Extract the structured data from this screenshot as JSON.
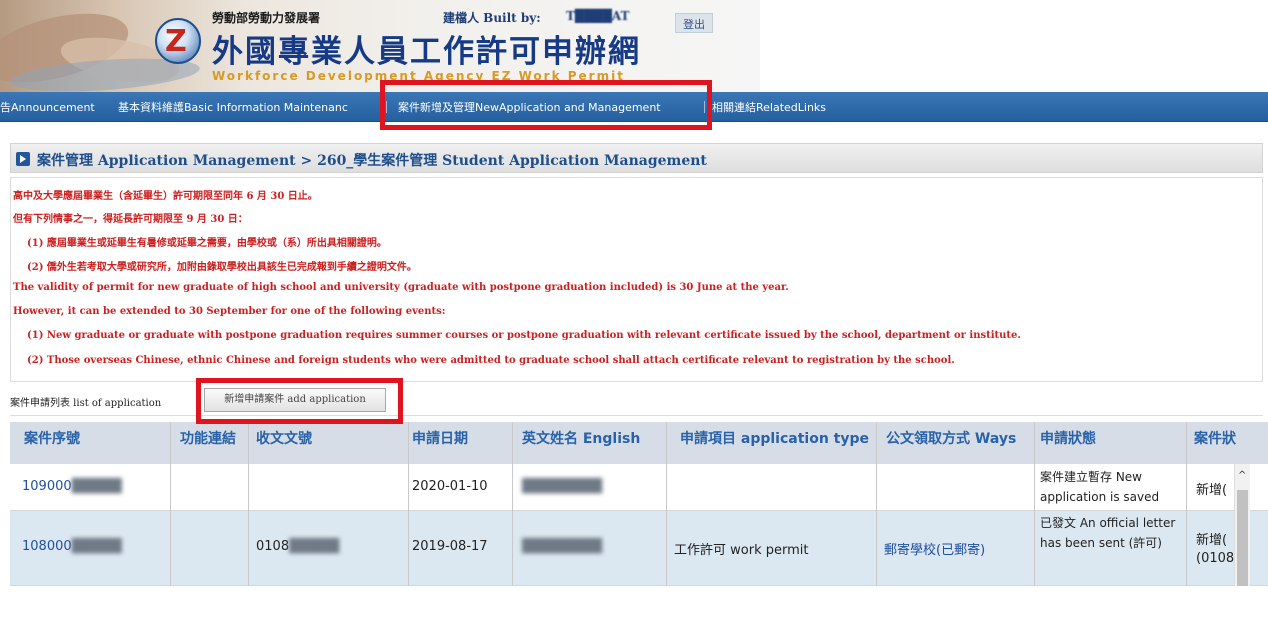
{
  "banner": {
    "agency": "勞動部勞動力發展署",
    "builder_prefix": "建檔人 Built by: ",
    "builder_name": "T████AT",
    "logout_label": "登出",
    "site_title": "外國專業人員工作許可申辦網",
    "site_subtitle": "Workforce Development Agency EZ Work Permit"
  },
  "menu": {
    "items": [
      "告Announcement",
      "基本資料維護Basic Information Maintenanc",
      "案件新增及管理NewApplication and Management",
      "相關連結RelatedLinks"
    ]
  },
  "section": {
    "title": "案件管理 Application Management > 260_學生案件管理 Student Application Management"
  },
  "notice": {
    "lines": [
      "高中及大學應屆畢業生（含延畢生）許可期限至同年 6 月 30 日止。",
      "但有下列情事之一，得延長許可期限至 9 月 30 日：",
      "(1) 應屆畢業生或延畢生有暑修或延畢之需要，由學校或（系）所出具相關證明。",
      "(2) 僑外生若考取大學或研究所，加附由錄取學校出具該生已完成報到手續之證明文件。",
      "The validity of permit for new graduate of high school and university (graduate with postpone graduation included) is 30 June at the year.",
      "However, it can be extended to 30 September for one of the following events:",
      "(1) New graduate or graduate with postpone graduation requires summer courses or postpone graduation with relevant certificate issued by the school, department or institute.",
      "(2) Those overseas Chinese, ethnic Chinese and foreign students who were admitted to graduate school shall attach certificate relevant to registration by the school."
    ]
  },
  "list": {
    "label": "案件申請列表 list of application",
    "add_button": "新增申請案件 add application"
  },
  "table": {
    "headers": [
      "案件序號",
      "功能連結",
      "收文文號",
      "申請日期",
      "英文姓名 English",
      "申請項目 application type",
      "公文領取方式 Ways",
      "申請狀態",
      "案件狀"
    ],
    "rows": [
      {
        "case_no_prefix": "109000",
        "case_no_hidden": "█████",
        "doc_no_prefix": "",
        "doc_no_hidden": "",
        "date": "2020-01-10",
        "name_hidden": "████████",
        "type": "",
        "way": "",
        "status": "案件建立暫存 New application is saved",
        "case_status": "新增(",
        "case_status_2": ""
      },
      {
        "case_no_prefix": "108000",
        "case_no_hidden": "█████",
        "doc_no_prefix": "0108",
        "doc_no_hidden": "█████",
        "date": "2019-08-17",
        "name_hidden": "████████",
        "type": "工作許可 work permit",
        "way": "郵寄學校(已郵寄)",
        "status": "已發文 An official letter has been sent (許可)",
        "case_status": "新增(",
        "case_status_2": "(0108"
      }
    ]
  },
  "colors": {
    "menu_bar": "#2b68a8",
    "notice_text": "#cc1f1f",
    "header_text": "#2a62a9",
    "callout": "#e0141e",
    "row_alt": "#dce8f1"
  },
  "icons": [
    "agency-logo",
    "section-arrow-icon",
    "scroll-up-icon"
  ]
}
